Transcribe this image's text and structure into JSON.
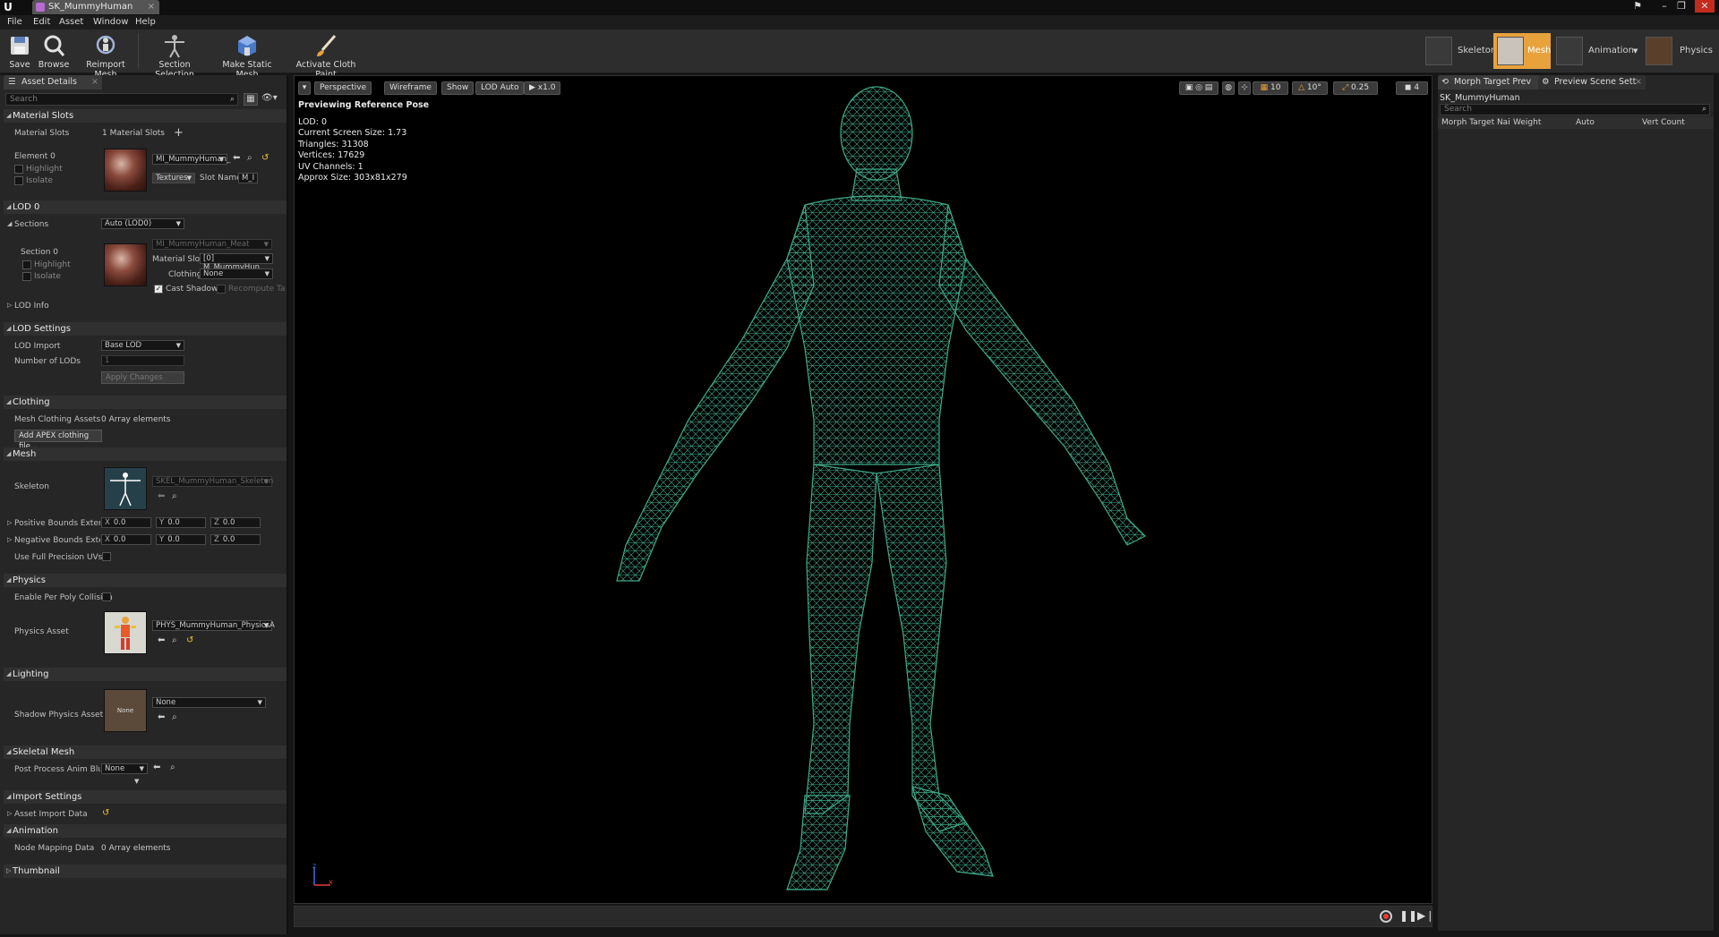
{
  "window": {
    "tab_title": "SK_MummyHuman",
    "logo": "U"
  },
  "menu": {
    "items": [
      "File",
      "Edit",
      "Asset",
      "Window",
      "Help"
    ]
  },
  "toolbar": {
    "buttons": [
      {
        "label": "Save",
        "icon": "save-icon"
      },
      {
        "label": "Browse",
        "icon": "browse-icon"
      },
      {
        "label": "Reimport Mesh",
        "icon": "reimport-icon"
      },
      {
        "label": "Section Selection",
        "icon": "section-selection-icon"
      },
      {
        "label": "Make Static Mesh",
        "icon": "static-mesh-icon"
      },
      {
        "label": "Activate Cloth Paint",
        "icon": "cloth-paint-icon"
      }
    ],
    "modes": [
      "Skeleton",
      "Mesh",
      "Animation",
      "Physics"
    ],
    "active_mode": "Mesh",
    "accent": "#e8a23c"
  },
  "details": {
    "tab": "Asset Details",
    "search_placeholder": "Search",
    "material_slots": {
      "header": "Material Slots",
      "label": "Material Slots",
      "count": "1 Material Slots",
      "element_label": "Element 0",
      "highlight": "Highlight",
      "isolate": "Isolate",
      "material": "MI_MummyHuman_",
      "textures": "Textures",
      "slot_name_label": "Slot Name",
      "slot_name_value": "M_I"
    },
    "lod0": {
      "header": "LOD 0",
      "sections_label": "Sections",
      "sections_value": "Auto (LOD0)",
      "section_label": "Section 0",
      "highlight": "Highlight",
      "isolate": "Isolate",
      "material": "MI_MummyHuman_Meat",
      "material_slot_label": "Material Slot",
      "material_slot_value": "[0] M_MummyHun",
      "clothing_label": "Clothing",
      "clothing_value": "None",
      "cast_shadows": "Cast Shadows",
      "recompute_tangent": "Recompute Tange",
      "lod_info": "LOD Info"
    },
    "lod_settings": {
      "header": "LOD Settings",
      "lod_import_label": "LOD Import",
      "lod_import_value": "Base LOD",
      "num_lods_label": "Number of LODs",
      "num_lods_value": "1",
      "apply": "Apply Changes"
    },
    "clothing": {
      "header": "Clothing",
      "assets_label": "Mesh Clothing Assets",
      "assets_value": "0 Array elements",
      "add_button": "Add APEX clothing file..."
    },
    "mesh": {
      "header": "Mesh",
      "skeleton_label": "Skeleton",
      "skeleton_value": "SKEL_MummyHuman_Skeleton",
      "pos_bounds_label": "Positive Bounds Extensi",
      "neg_bounds_label": "Negative Bounds Extensi",
      "x": "X",
      "y": "Y",
      "z": "Z",
      "zero": "0.0",
      "full_precision_label": "Use Full Precision UVs"
    },
    "physics": {
      "header": "Physics",
      "per_poly_label": "Enable Per Poly Collision",
      "asset_label": "Physics Asset",
      "asset_value": "PHYS_MummyHuman_PhysicsA"
    },
    "lighting": {
      "header": "Lighting",
      "shadow_label": "Shadow Physics Asset",
      "shadow_value": "None",
      "thumb_text": "None"
    },
    "skeletal_mesh": {
      "header": "Skeletal Mesh",
      "post_process_label": "Post Process Anim Bluep",
      "post_process_value": "None"
    },
    "import_settings": {
      "header": "Import Settings",
      "asset_import_label": "Asset Import Data"
    },
    "animation": {
      "header": "Animation",
      "node_mapping_label": "Node Mapping Data",
      "node_mapping_value": "0 Array elements"
    },
    "thumbnail": {
      "header": "Thumbnail"
    }
  },
  "viewport": {
    "buttons": [
      "Perspective",
      "Wireframe",
      "Show",
      "LOD Auto",
      "x1.0"
    ],
    "right_values": [
      "10",
      "10°",
      "0.25",
      "4"
    ],
    "preview_label": "Previewing Reference Pose",
    "stats": [
      "LOD: 0",
      "Current Screen Size: 1.73",
      "Triangles: 31308",
      "Vertices: 17629",
      "UV Channels: 1",
      "Approx Size: 303x81x279"
    ],
    "axis": {
      "x": "x",
      "z": "z"
    },
    "wire_color": "#3fa889"
  },
  "right_panel": {
    "tabs": [
      "Morph Target Prev",
      "Preview Scene Sett"
    ],
    "asset_name": "SK_MummyHuman",
    "search_placeholder": "Search",
    "columns": [
      "Morph Target Nai",
      "Weight",
      "Auto",
      "Vert Count"
    ]
  }
}
